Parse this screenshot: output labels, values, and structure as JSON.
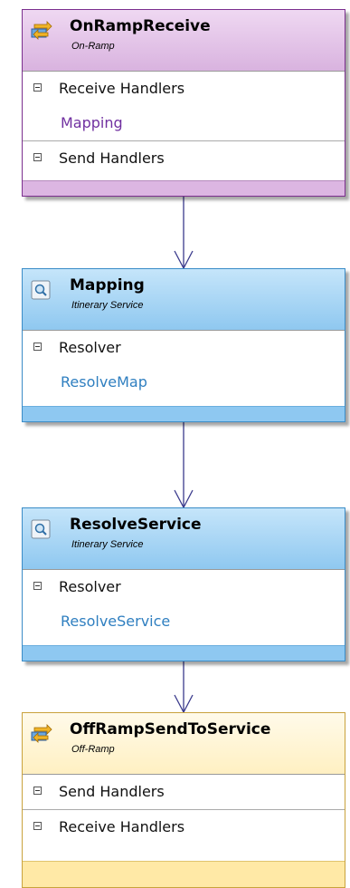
{
  "shapes": [
    {
      "title": "OnRampReceive",
      "subtitle": "On-Ramp",
      "icon": "ramp-icon",
      "rows": [
        {
          "label": "Receive Handlers",
          "kind": "group"
        },
        {
          "label": "Mapping",
          "kind": "child"
        },
        {
          "label": "Send Handlers",
          "kind": "group"
        }
      ],
      "colors": {
        "header": "#e6c8ea",
        "border": "#7b2f8e",
        "footer": "#dcb6e2",
        "child_text": "#7030a0"
      }
    },
    {
      "title": "Mapping",
      "subtitle": "Itinerary Service",
      "icon": "service-icon",
      "rows": [
        {
          "label": "Resolver",
          "kind": "group"
        },
        {
          "label": "ResolveMap",
          "kind": "child"
        }
      ],
      "colors": {
        "header": "#9dd1f5",
        "border": "#3b8cc7",
        "footer": "#8ec8f1",
        "child_text": "#2f7fc0"
      }
    },
    {
      "title": "ResolveService",
      "subtitle": "Itinerary Service",
      "icon": "service-icon",
      "rows": [
        {
          "label": "Resolver",
          "kind": "group"
        },
        {
          "label": "ResolveService",
          "kind": "child"
        }
      ],
      "colors": {
        "header": "#9dd1f5",
        "border": "#3b8cc7",
        "footer": "#8ec8f1",
        "child_text": "#2f7fc0"
      }
    },
    {
      "title": "OffRampSendToService",
      "subtitle": "Off-Ramp",
      "icon": "ramp-icon",
      "rows": [
        {
          "label": "Send Handlers",
          "kind": "group"
        },
        {
          "label": "Receive Handlers",
          "kind": "group"
        }
      ],
      "colors": {
        "header": "#fff0c2",
        "border": "#c9a23c",
        "footer": "#ffe9a6",
        "child_text": "#000000"
      }
    }
  ],
  "connector_color": "#3a3a8c"
}
